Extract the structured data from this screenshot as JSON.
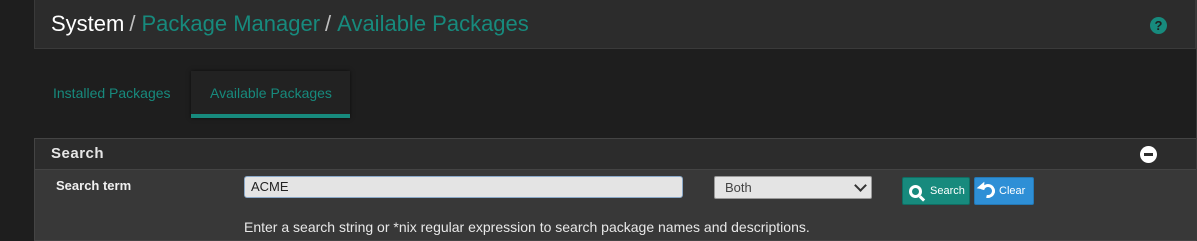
{
  "breadcrumb": {
    "root": "System",
    "separator": "/",
    "items": [
      "Package Manager",
      "Available Packages"
    ]
  },
  "header": {
    "help_icon": "question-circle"
  },
  "tabs": [
    {
      "label": "Installed Packages",
      "active": false
    },
    {
      "label": "Available Packages",
      "active": true
    }
  ],
  "panel": {
    "title": "Search",
    "collapse_icon": "minus-circle",
    "field_label": "Search term",
    "search_value": "ACME",
    "scope_selected": "Both",
    "search_button": "Search",
    "clear_button": "Clear",
    "help_text": "Enter a search string or *nix regular expression to search package names and descriptions."
  },
  "colors": {
    "accent": "#178a7d",
    "clear_button": "#2e8fd6",
    "background": "#1e1e1e"
  }
}
